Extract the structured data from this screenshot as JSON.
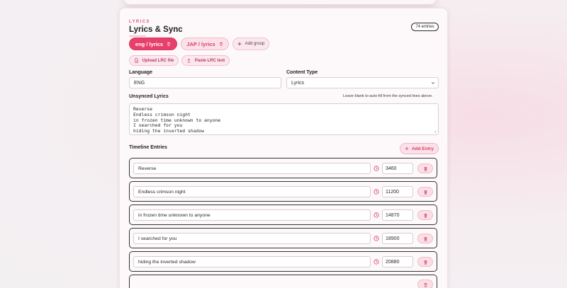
{
  "section": {
    "eyebrow": "LYRICS",
    "title": "Lyrics & Sync",
    "count_badge": "74 entries"
  },
  "groups": [
    {
      "label": "eng / lyrics",
      "active": true
    },
    {
      "label": "JAP / lyrics",
      "active": false
    }
  ],
  "add_group_label": "Add group",
  "upload_lrc_label": "Upload LRC file",
  "paste_lrc_label": "Paste LRC text",
  "language": {
    "label": "Language",
    "value": "ENG"
  },
  "content_type": {
    "label": "Content Type",
    "value": "Lyrics"
  },
  "unsynced": {
    "label": "Unsynced Lyrics",
    "hint": "Leave blank to auto-fill from the synced lines above.",
    "lines": [
      "Reverse",
      "Endless crimson night",
      "in frozen time unknown to anyone",
      "I searched for you",
      "hiding the inverted shadow"
    ]
  },
  "timeline": {
    "label": "Timeline Entries",
    "add_entry_label": "Add Entry",
    "entries": [
      {
        "text": "Reverse",
        "time": "3460"
      },
      {
        "text": "Endless crimson night",
        "time": "11200"
      },
      {
        "text": "in frozen time unknown to anyone",
        "time": "14870"
      },
      {
        "text": "I searched for you",
        "time": "18900"
      },
      {
        "text": "hiding the inverted shadow",
        "time": "20880"
      }
    ]
  },
  "colors": {
    "accent": "#e8406c",
    "accent_soft": "#fbe1e9",
    "background": "#f5eef1"
  },
  "icons": {
    "group_delete": "trash-icon",
    "add": "plus-icon",
    "upload": "file-icon",
    "paste": "upload-icon",
    "timestamp": "clock-icon",
    "entry_delete": "trash-icon"
  }
}
